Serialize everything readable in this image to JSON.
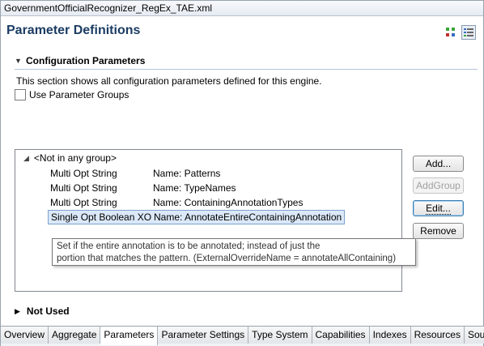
{
  "window": {
    "tab_title": "GovernmentOfficialRecognizer_RegEx_TAE.xml"
  },
  "page": {
    "title": "Parameter Definitions"
  },
  "section": {
    "title": "Configuration Parameters",
    "description": "This section shows all configuration parameters defined for this engine.",
    "use_groups_label": "Use Parameter Groups",
    "use_groups_checked": false
  },
  "tree": {
    "group_label": "<Not in any group>",
    "params": [
      {
        "type": "Multi  Opt String",
        "name": "Name: Patterns"
      },
      {
        "type": "Multi  Opt String",
        "name": "Name: TypeNames"
      },
      {
        "type": "Multi  Opt String",
        "name": "Name: ContainingAnnotationTypes"
      },
      {
        "type": "Single Opt Boolean XO",
        "name": "Name: AnnotateEntireContainingAnnotation"
      }
    ]
  },
  "tooltip": {
    "line1": "Set if the entire annotation is to be annotated; instead of just the",
    "line2": "portion that matches the pattern. (ExternalOverrideName = annotateAllContaining)"
  },
  "buttons": {
    "add": "Add...",
    "add_group": "AddGroup",
    "edit": "Edit...",
    "remove": "Remove"
  },
  "not_used": {
    "label": "Not Used"
  },
  "tabs": [
    "Overview",
    "Aggregate",
    "Parameters",
    "Parameter Settings",
    "Type System",
    "Capabilities",
    "Indexes",
    "Resources",
    "Source"
  ],
  "active_tab": "Parameters"
}
